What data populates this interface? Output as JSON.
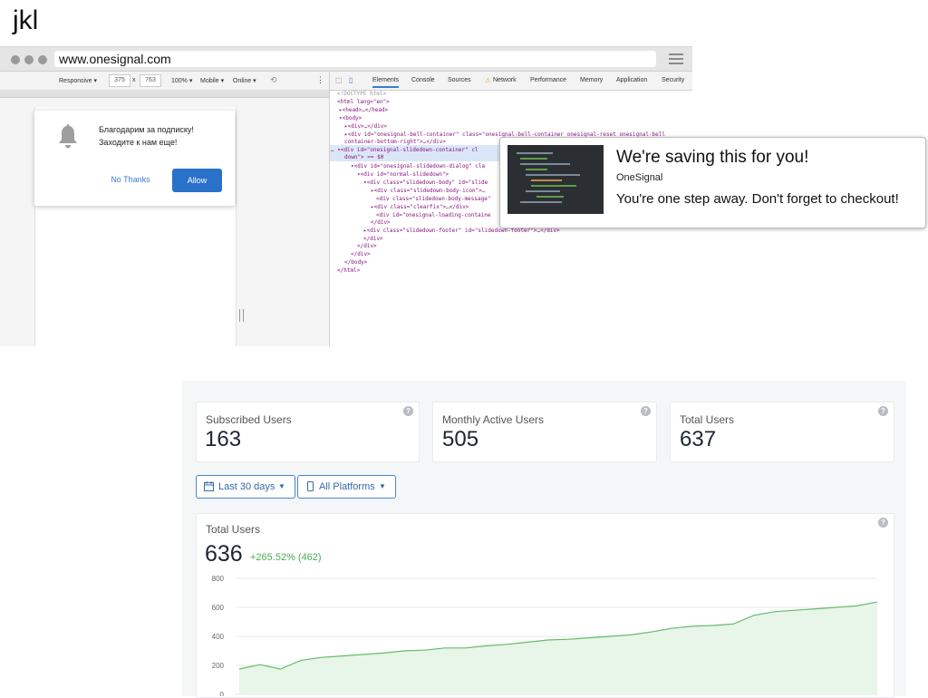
{
  "header": {
    "title": "jkl"
  },
  "browser": {
    "url": "www.onesignal.com",
    "device_toolbar": {
      "mode": "Responsive ▾",
      "width": "375",
      "x": "x",
      "height": "763",
      "zoom": "100% ▾",
      "network_mode": "Mobile ▾",
      "online": "Online ▾"
    },
    "devtools_tabs": [
      "Elements",
      "Console",
      "Sources",
      "Network",
      "Performance",
      "Memory",
      "Application",
      "Security"
    ],
    "prompt": {
      "message_line1": "Благодарим за подписку!",
      "message_line2": "Заходите к нам еще!",
      "no_thanks_label": "No Thanks",
      "allow_label": "Allow"
    },
    "code_lines": [
      "<!DOCTYPE html>",
      "<html lang=\"en\">",
      "▸<head>…</head>",
      "▾<body>",
      "▸<div>…</div>",
      "▸<div id=\"onesignal-bell-container\" class=\"onesignal-bell-container onesignal-reset onesignal-bell",
      "container-bottom-right\">…</div>",
      "… ▾<div id=\"onesignal-slidedown-container\" cl",
      "down\"> == $0",
      "▾<div id=\"onesignal-slidedown-dialog\" cla",
      "▾<div id=\"normal-slidedown\">",
      "▾<div class=\"slidedown-body\" id=\"slide",
      "▸<div class=\"slidedown-body-icon\">…",
      "<div class=\"slidedown-body-message\"",
      "▸<div class=\"clearfix\">…</div>",
      "<div id=\"onesignal-loading-containe",
      "</div>",
      "▸<div class=\"slidedown-footer\" id=\"slidedown-footer\">…</div>",
      "</div>",
      "</div>",
      "</div>",
      "</body>",
      "</html>"
    ]
  },
  "notification": {
    "title": "We're saving this for you!",
    "source": "OneSignal",
    "body": "You're one step away.  Don't forget to checkout!"
  },
  "dashboard": {
    "stats": [
      {
        "label": "Subscribed Users",
        "value": "163"
      },
      {
        "label": "Monthly Active Users",
        "value": "505"
      },
      {
        "label": "Total Users",
        "value": "637"
      }
    ],
    "filters": {
      "date_range": "Last 30 days",
      "platforms": "All Platforms"
    },
    "chart": {
      "title": "Total Users",
      "total": "636",
      "change": "+265.52% (462)"
    }
  },
  "colors": {
    "accent": "#2a72c9",
    "growth": "#4caf50",
    "area_fill": "#e8f5e9",
    "area_line": "#66bb6a"
  },
  "chart_data": {
    "type": "area",
    "title": "Total Users",
    "xlabel": "",
    "ylabel": "",
    "ylim": [
      0,
      800
    ],
    "yticks": [
      "800",
      "600",
      "400",
      "200",
      "0"
    ],
    "values": [
      175,
      205,
      175,
      235,
      255,
      265,
      275,
      285,
      300,
      305,
      320,
      320,
      335,
      345,
      360,
      375,
      380,
      390,
      400,
      410,
      430,
      455,
      470,
      475,
      485,
      545,
      570,
      580,
      590,
      600,
      610,
      637
    ]
  }
}
